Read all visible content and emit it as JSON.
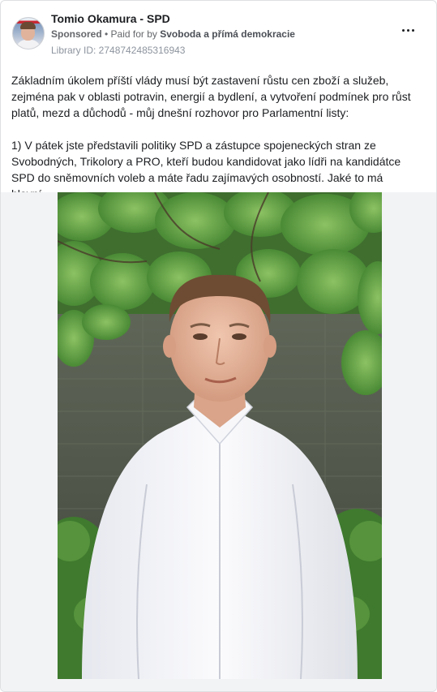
{
  "post": {
    "page_name": "Tomio Okamura - SPD",
    "sponsored_label": "Sponsored",
    "paid_for_prefix": " • Paid for by ",
    "paid_for_by": "Svoboda a přímá demokracie",
    "library_id": "Library ID: 2748742485316943",
    "text_paragraph_1": "Základním úkolem příští vlády musí být zastavení růstu cen zboží a služeb, zejména pak v oblasti potravin, energií a bydlení, a vytvoření podmínek pro růst platů, mezd a důchodů - můj dnešní rozhovor pro Parlamentní listy:",
    "text_paragraph_2": "1) V pátek jste představili politiky SPD a zástupce spojeneckých stran ze Svobodných, Trikolory a PRO, kteří budou kandidovat jako lídři na kandidátce SPD do sněmovních voleb a máte řadu zajímavých osobností. Jaké to má hlavní…"
  },
  "icons": {
    "avatar": "profile-picture",
    "more": "more-options-icon"
  }
}
